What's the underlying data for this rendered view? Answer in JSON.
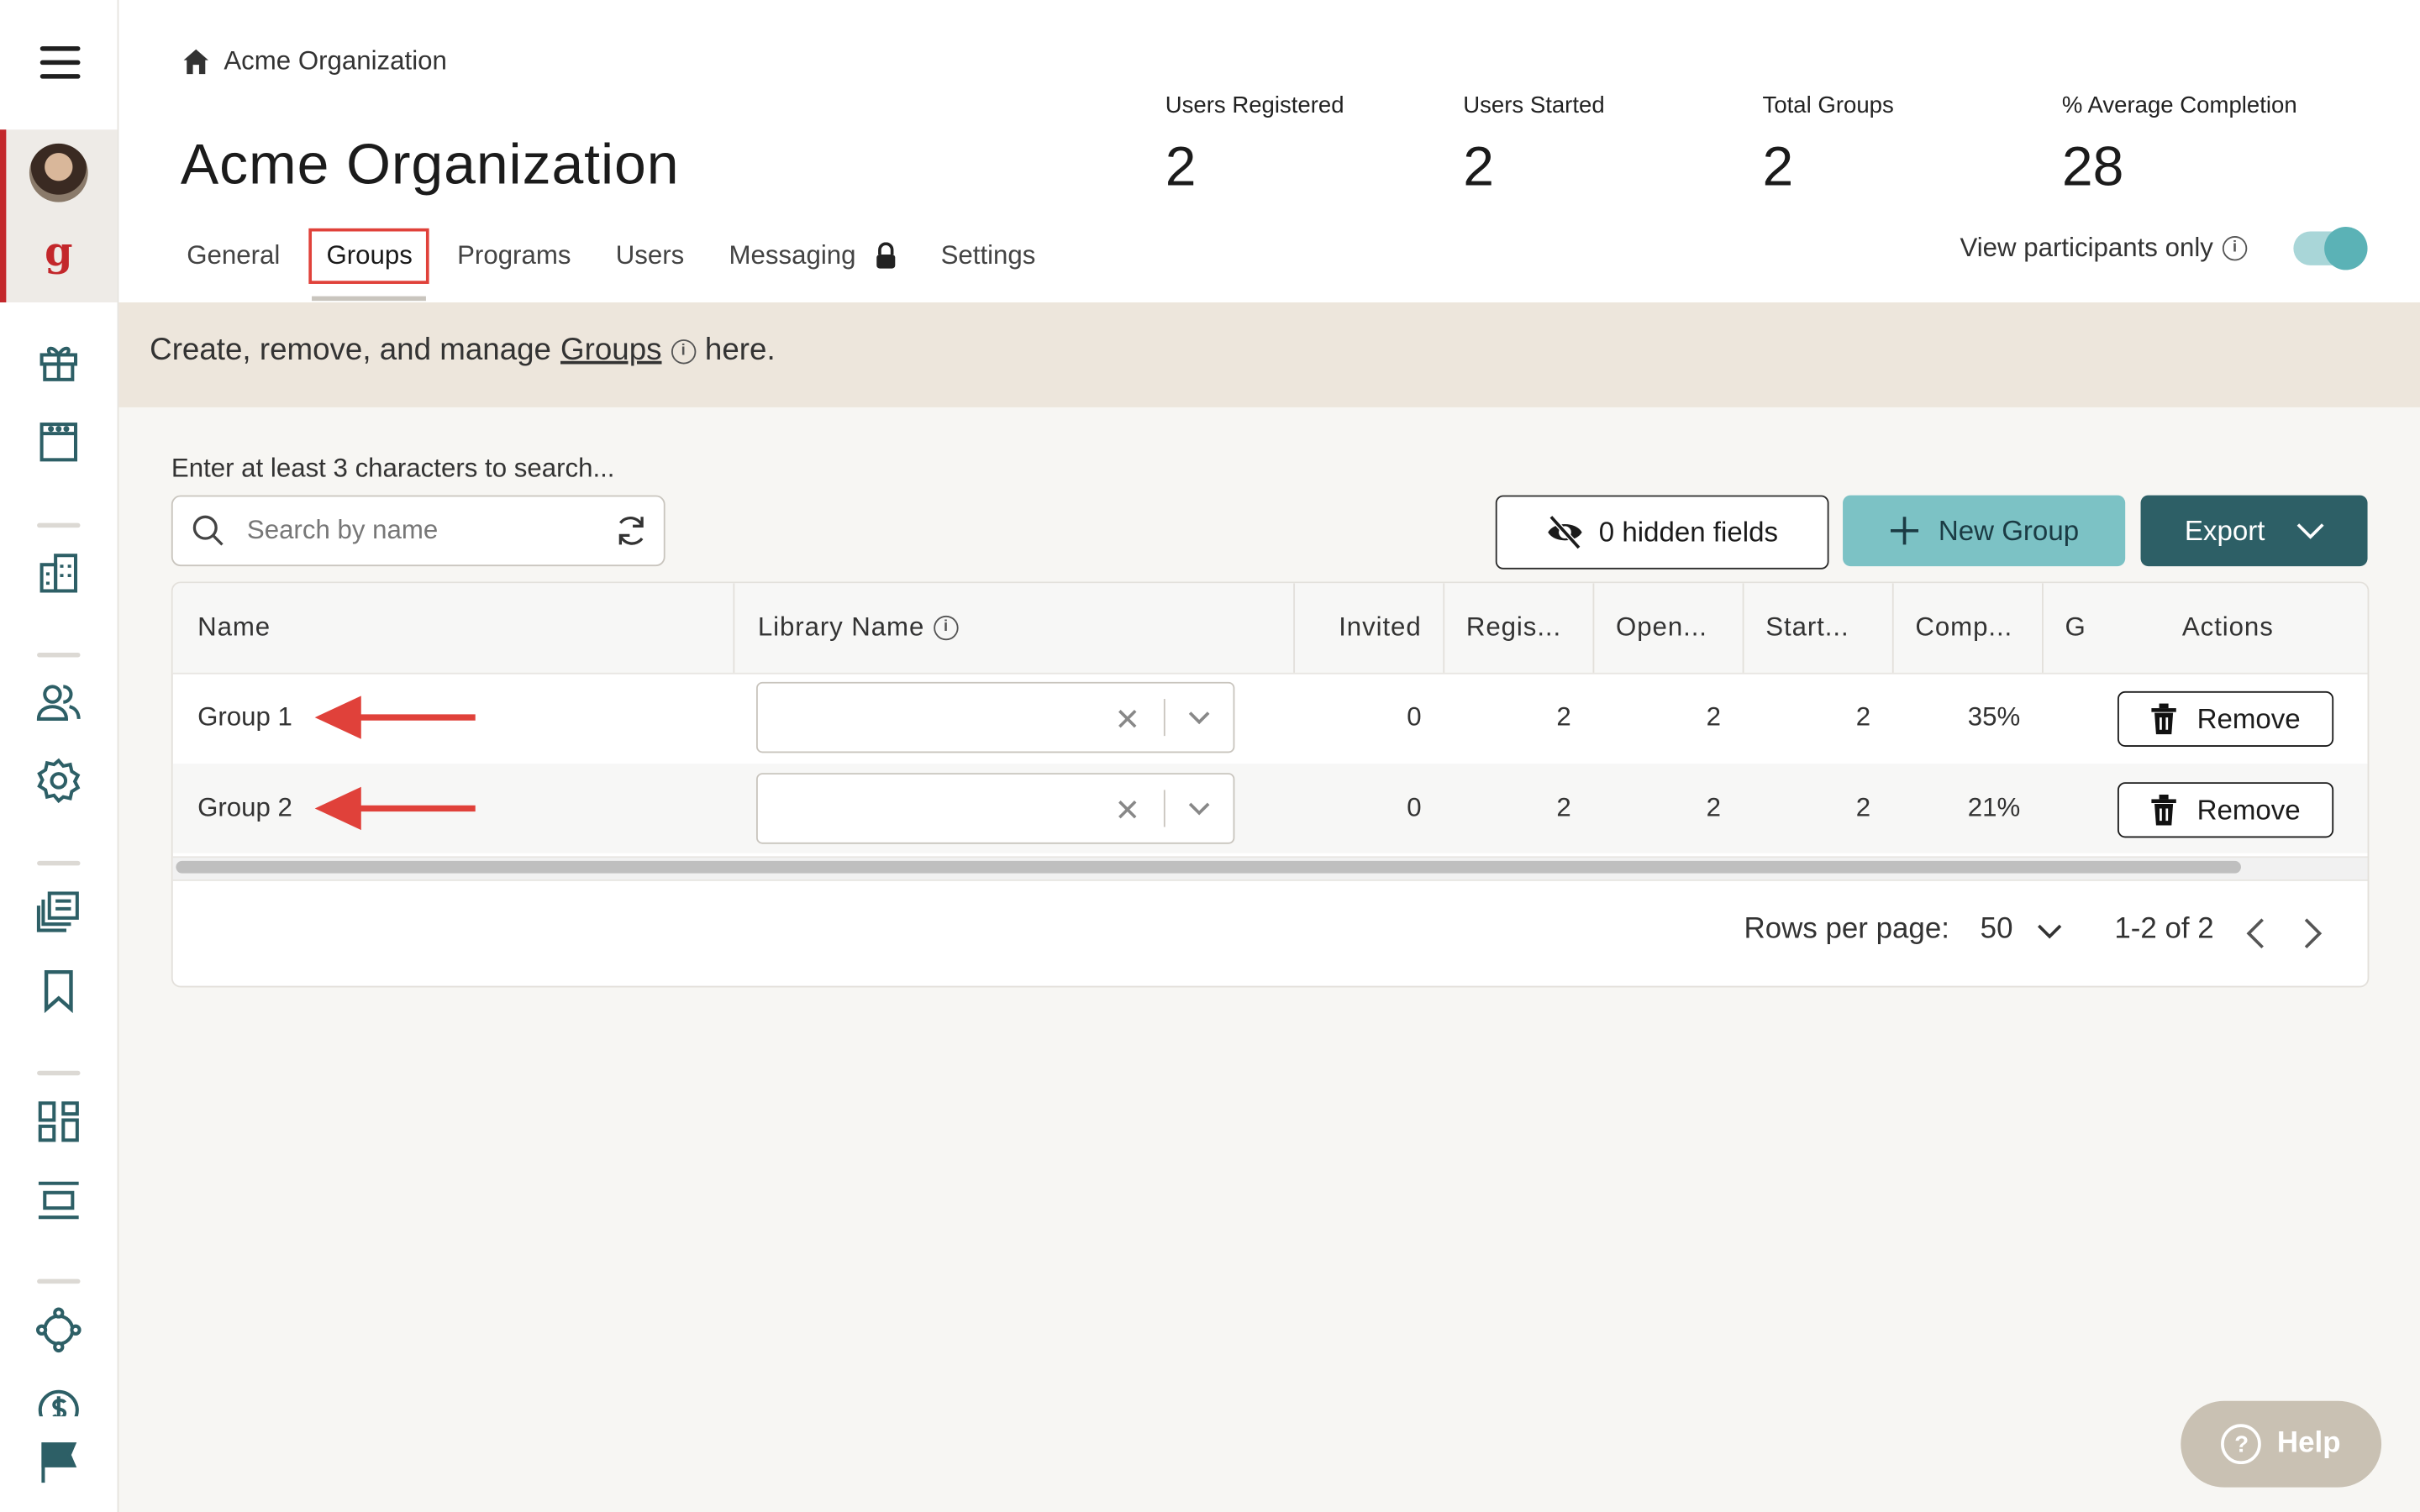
{
  "breadcrumb": {
    "label": "Acme Organization"
  },
  "page": {
    "title": "Acme Organization"
  },
  "stats": [
    {
      "label": "Users Registered",
      "value": "2"
    },
    {
      "label": "Users Started",
      "value": "2"
    },
    {
      "label": "Total Groups",
      "value": "2"
    },
    {
      "label": "% Average Completion",
      "value": "28"
    }
  ],
  "tabs": [
    {
      "label": "General"
    },
    {
      "label": "Groups"
    },
    {
      "label": "Programs"
    },
    {
      "label": "Users"
    },
    {
      "label": "Messaging"
    },
    {
      "label": "Settings"
    }
  ],
  "view_toggle": {
    "label": "View participants only",
    "on": true
  },
  "banner": {
    "prefix": "Create, remove, and manage",
    "link": "Groups",
    "suffix": "here."
  },
  "search": {
    "hint": "Enter at least 3 characters to search...",
    "placeholder": "Search by name"
  },
  "toolbar": {
    "hidden_fields": "0 hidden fields",
    "new_group": "New Group",
    "export": "Export"
  },
  "table": {
    "columns": [
      "Name",
      "Library Name",
      "Invited",
      "Regis...",
      "Open...",
      "Start...",
      "Comp...",
      "G",
      "Actions"
    ],
    "rows": [
      {
        "name": "Group 1",
        "invited": "0",
        "registered": "2",
        "opened": "2",
        "started": "2",
        "completion": "35%",
        "action": "Remove"
      },
      {
        "name": "Group 2",
        "invited": "0",
        "registered": "2",
        "opened": "2",
        "started": "2",
        "completion": "21%",
        "action": "Remove"
      }
    ]
  },
  "pagination": {
    "rows_label": "Rows per page:",
    "rows_value": "50",
    "range": "1-2 of 2"
  },
  "help": {
    "label": "Help"
  },
  "colors": {
    "accent": "#c3272b",
    "teal": "#7cc2c5",
    "dark_teal": "#2d5f66",
    "annotation_red": "#e0413a"
  }
}
